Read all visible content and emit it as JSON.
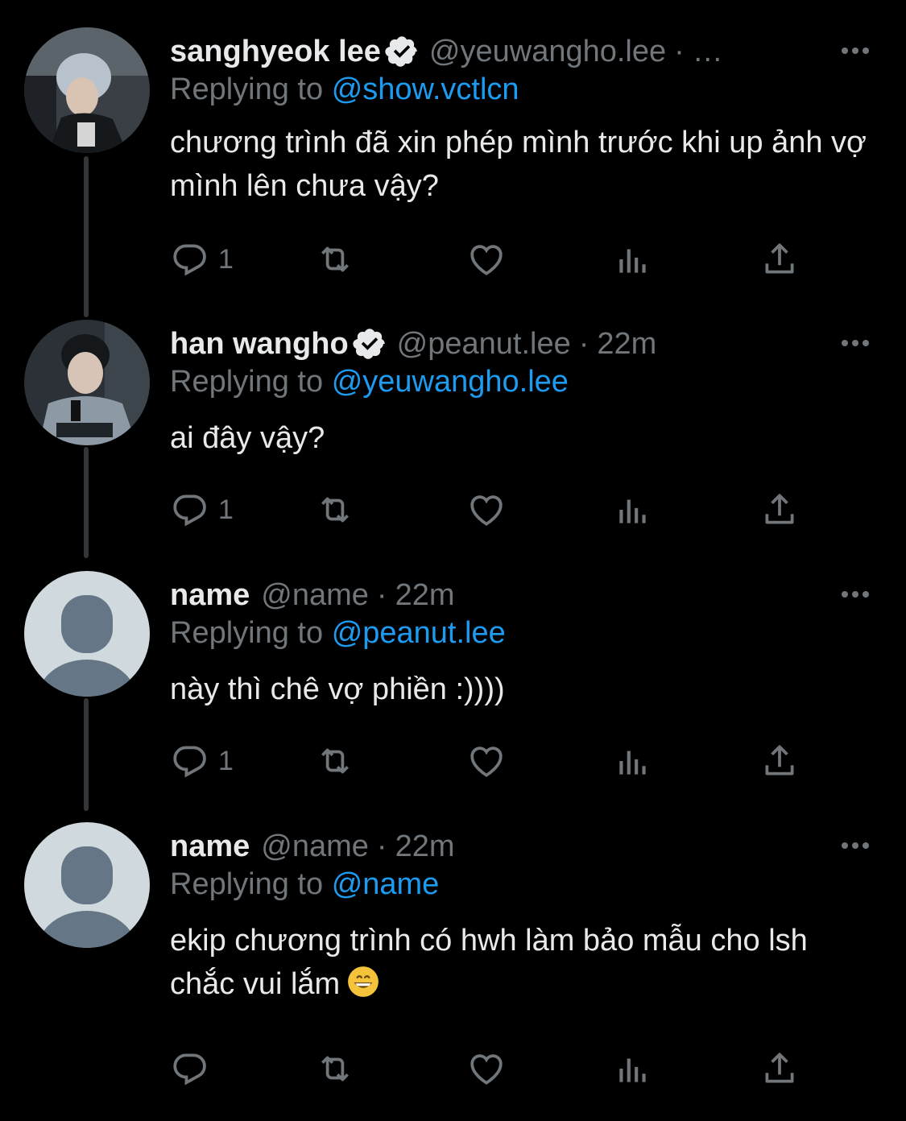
{
  "tweets": [
    {
      "display_name": "sanghyeok lee",
      "verified": true,
      "handle": "@yeuwangho.lee",
      "time": "…",
      "replying_label": "Replying to",
      "replying_to": "@show.vctlcn",
      "text": "chương trình đã xin phép mình trước khi up ảnh vợ mình lên chưa vậy?",
      "reply_count": "1"
    },
    {
      "display_name": "han wangho",
      "verified": true,
      "handle": "@peanut.lee",
      "time": "22m",
      "replying_label": "Replying to",
      "replying_to": "@yeuwangho.lee",
      "text": "ai đây vậy?",
      "reply_count": "1"
    },
    {
      "display_name": "name",
      "verified": false,
      "handle": "@name",
      "time": "22m",
      "replying_label": "Replying to",
      "replying_to": "@peanut.lee",
      "text": "này thì chê vợ phiền :))))",
      "reply_count": "1"
    },
    {
      "display_name": "name",
      "verified": false,
      "handle": "@name",
      "time": "22m",
      "replying_label": "Replying to",
      "replying_to": "@name",
      "text": "ekip chương trình có hwh làm bảo mẫu cho lsh chắc vui lắm",
      "reply_count": ""
    }
  ],
  "colors": {
    "background": "#000000",
    "text_primary": "#e7e9ea",
    "text_secondary": "#71767b",
    "accent": "#1d9bf0",
    "thread_line": "#333639",
    "default_avatar_bg": "#cfd9de",
    "default_avatar_fg": "#657786"
  },
  "icons": [
    "reply-icon",
    "retweet-icon",
    "like-icon",
    "views-icon",
    "share-icon",
    "more-icon",
    "verified-badge-icon",
    "grinning-emoji"
  ]
}
